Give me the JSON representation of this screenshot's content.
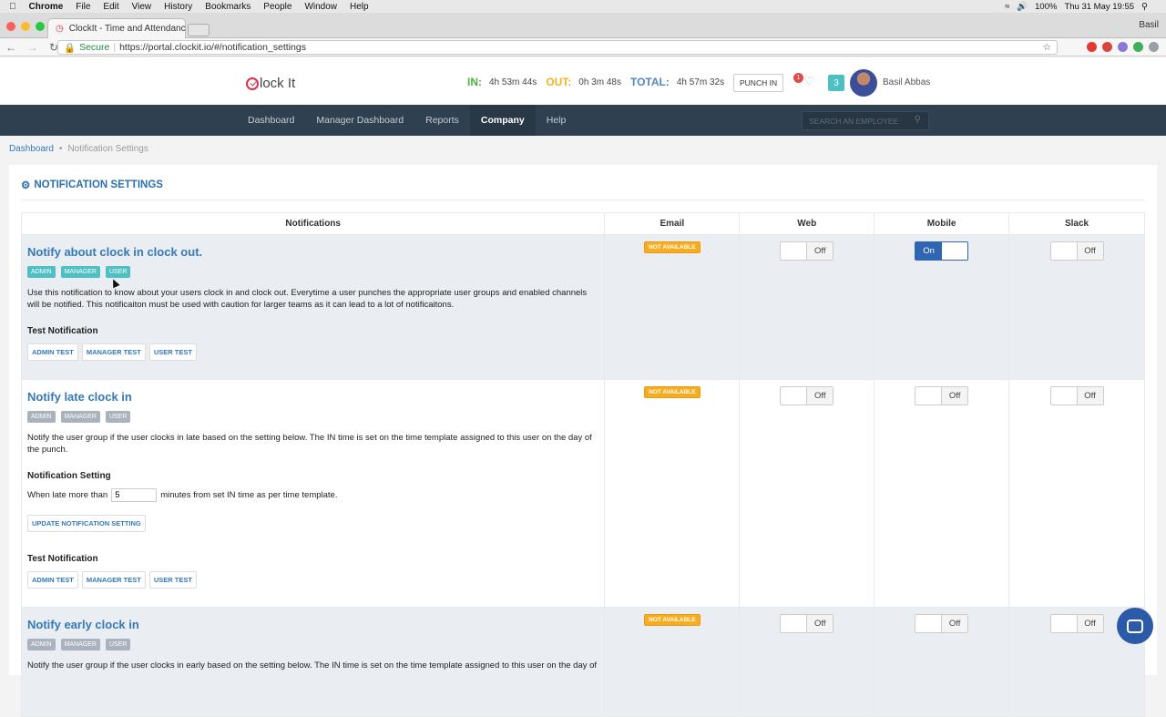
{
  "os_menu": {
    "app": "Chrome",
    "items": [
      "File",
      "Edit",
      "View",
      "History",
      "Bookmarks",
      "People",
      "Window",
      "Help"
    ],
    "battery": "100%",
    "clock": "Thu 31 May  19:55"
  },
  "browser": {
    "tab_title": "ClockIt - Time and Attendance",
    "profile": "Basil",
    "secure_label": "Secure",
    "url": "https://portal.clockit.io/#/notification_settings"
  },
  "header": {
    "logo_text": "lock It",
    "in_label": "IN:",
    "in_value": "4h 53m 44s",
    "out_label": "OUT:",
    "out_value": "0h 3m 48s",
    "total_label": "TOTAL:",
    "total_value": "4h 57m 32s",
    "punch_label": "PUNCH IN",
    "notification_count": "1",
    "team_count": "3",
    "user_name": "Basil Abbas",
    "colors": {
      "in": "#4db043",
      "out": "#f0b324",
      "total": "#4f87c4"
    }
  },
  "nav": {
    "items": [
      "Dashboard",
      "Manager Dashboard",
      "Reports",
      "Company",
      "Help"
    ],
    "active": "Company",
    "search_placeholder": "SEARCH AN EMPLOYEE"
  },
  "breadcrumb": {
    "home": "Dashboard",
    "current": "Notification Settings"
  },
  "panel": {
    "title": "NOTIFICATION SETTINGS"
  },
  "table": {
    "headers": [
      "Notifications",
      "Email",
      "Web",
      "Mobile",
      "Slack"
    ],
    "rows": [
      {
        "title": "Notify about clock in clock out.",
        "tags": [
          "ADMIN",
          "MANAGER",
          "USER"
        ],
        "description": "Use this notification to know about your users clock in and clock out. Everytime a user punches the appropriate user groups and enabled channels will be notified. This notificaiton must be used with caution for larger teams as it can lead to a lot of notificaitons.",
        "test_heading": "Test Notification",
        "test_buttons": [
          "ADMIN TEST",
          "MANAGER TEST",
          "USER TEST"
        ],
        "email": "NOT AVAILABLE",
        "web": "Off",
        "mobile": "On",
        "slack": "Off"
      },
      {
        "title": "Notify late clock in",
        "tags": [
          "ADMIN",
          "MANAGER",
          "USER"
        ],
        "description": "Notify the user group if the user clocks in late based on the setting below. The IN time is set on the time template assigned to this user on the day of the punch.",
        "setting_heading": "Notification Setting",
        "setting_prefix": "When late more than",
        "setting_value": "5",
        "setting_suffix": "minutes from set IN time as per time template.",
        "update_button": "UPDATE NOTIFICATION SETTING",
        "test_heading": "Test Notification",
        "test_buttons": [
          "ADMIN TEST",
          "MANAGER TEST",
          "USER TEST"
        ],
        "email": "NOT AVAILABLE",
        "web": "Off",
        "mobile": "Off",
        "slack": "Off"
      },
      {
        "title": "Notify early clock in",
        "tags": [
          "ADMIN",
          "MANAGER",
          "USER"
        ],
        "description": "Notify the user group if the user clocks in early based on the setting below. The IN time is set on the time template assigned to this user on the day of",
        "email": "NOT AVAILABLE",
        "web": "Off",
        "mobile": "Off",
        "slack": "Off"
      }
    ]
  }
}
